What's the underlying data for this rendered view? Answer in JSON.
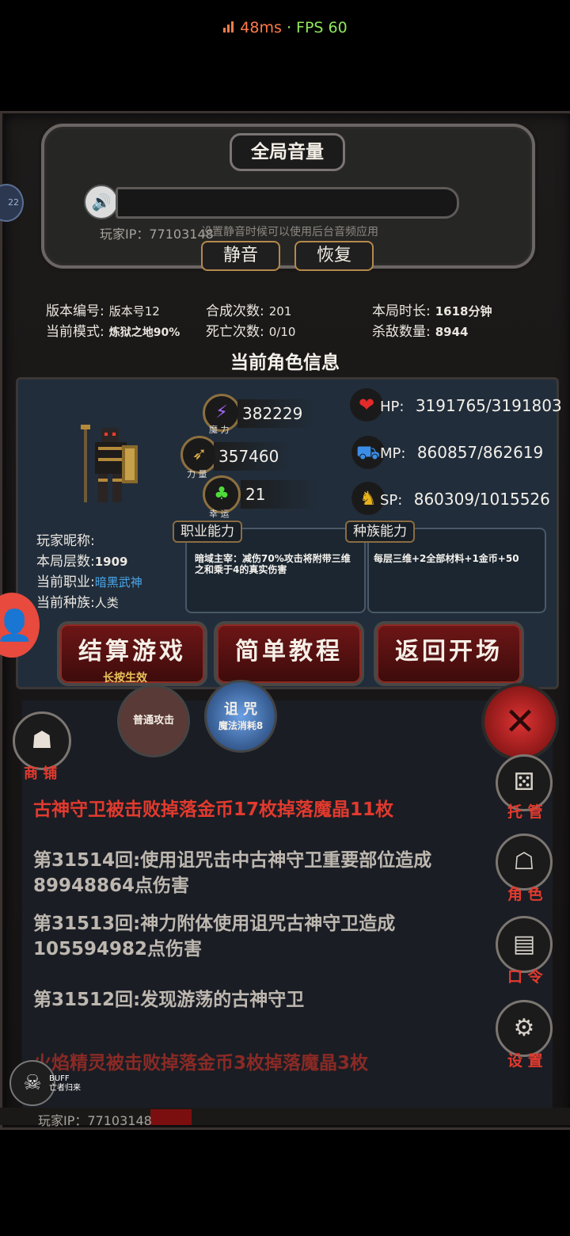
{
  "status": {
    "ping": "48ms",
    "fps": "FPS 60"
  },
  "volume": {
    "title": "全局音量",
    "hint": "设置静音时候可以使用后台音频应用",
    "mute_label": "静音",
    "restore_label": "恢复",
    "player_ip": "玩家IP：77103148"
  },
  "stats": {
    "version_label": "版本编号:",
    "version_value": "版本号12",
    "mode_label": "当前模式:",
    "mode_value": "炼狱之地90%",
    "synth_label": "合成次数:",
    "synth_value": "201",
    "death_label": "死亡次数:",
    "death_value": "0/10",
    "time_label": "本局时长:",
    "time_value": "1618分钟",
    "kills_label": "杀敌数量:",
    "kills_value": "8944"
  },
  "character": {
    "section_title": "当前角色信息",
    "magic_value": "382229",
    "magic_label": "魔 力",
    "strength_value": "357460",
    "strength_label": "力 量",
    "luck_value": "21",
    "luck_label": "幸 运",
    "hp_label": "HP:",
    "hp_value": "3191765/3191803",
    "mp_label": "MP:",
    "mp_value": "860857/862619",
    "sp_label": "SP:",
    "sp_value": "860309/1015526",
    "nickname_label": "玩家昵称:",
    "floor_label": "本局层数:",
    "floor_value": "1909",
    "job_label": "当前职业:",
    "job_value": "暗黑武神",
    "race_label": "当前种族:",
    "race_value": "人类",
    "job_ability_title": "职业能力",
    "job_ability_text": "暗域主宰：减伤70%攻击将附带三维之和乘于4的真实伤害",
    "race_ability_title": "种族能力",
    "race_ability_text": "每层三维+2全部材料+1金币+50"
  },
  "actions": {
    "settle_label": "结算游戏",
    "settle_sub": "长按生效",
    "tutorial_label": "简单教程",
    "back_label": "返回开场"
  },
  "skills": {
    "normal_attack": "普通攻击",
    "curse": "诅 咒",
    "curse_cost": "魔法消耗8"
  },
  "side": {
    "shop": "商 铺",
    "auto": "托 管",
    "role": "角 色",
    "code": "口 令",
    "settings": "设 置"
  },
  "log": [
    "古神守卫被击败掉落金币17枚掉落魔晶11枚",
    "第31514回:使用诅咒击中古神守卫重要部位造成89948864点伤害",
    "第31513回:神力附体使用诅咒古神守卫造成105594982点伤害",
    "第31512回:发现游荡的古神守卫",
    "火焰精灵被击败掉落金币3枚掉落魔晶3枚"
  ],
  "buff": {
    "title": "BUFF",
    "name": "亡者归来"
  },
  "footer": {
    "player_ip": "玩家IP：77103148"
  },
  "badge": {
    "left": "22"
  }
}
